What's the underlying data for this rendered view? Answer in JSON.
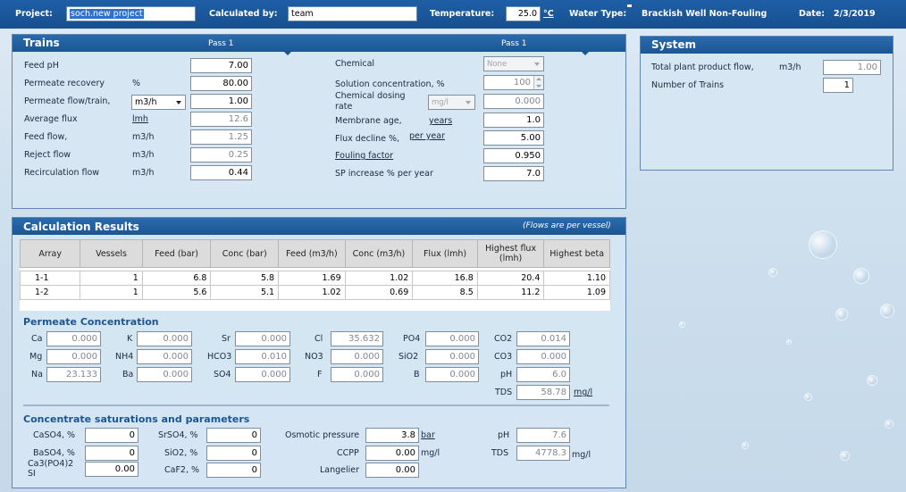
{
  "topbar": {
    "project_label": "Project:",
    "project_value": "soch.new project",
    "calculated_by_label": "Calculated by:",
    "calculated_by_value": "team",
    "temperature_label": "Temperature:",
    "temperature_value": "25.0",
    "temperature_unit": "°C",
    "water_type_label": "Water Type:",
    "water_type_value": "Brackish Well Non-Fouling",
    "date_label": "Date:",
    "date_value": "2/3/2019"
  },
  "trains": {
    "title": "Trains",
    "pass1_label_left": "Pass 1",
    "pass1_label_right": "Pass 1",
    "rows": [
      {
        "label": "Feed pH",
        "unit": "",
        "value": "7.00",
        "gray": false
      },
      {
        "label": "Permeate recovery",
        "unit": "%",
        "value": "80.00",
        "gray": false
      },
      {
        "label": "Permeate flow/train,",
        "unit": "m3/h",
        "value": "1.00",
        "gray": false
      },
      {
        "label": "Average flux",
        "unit": "lmh",
        "value": "12.6",
        "gray": true
      },
      {
        "label": "Feed flow,",
        "unit": "m3/h",
        "value": "1.25",
        "gray": true
      },
      {
        "label": "Reject flow",
        "unit": "m3/h",
        "value": "0.25",
        "gray": true
      },
      {
        "label": "Recirculation flow",
        "unit": "m3/h",
        "value": "0.44",
        "gray": false
      }
    ],
    "chemical_label": "Chemical",
    "chemical_value": "None",
    "solution_conc_label": "Solution concentration, %",
    "solution_conc_value": "100",
    "dosing_label_line1": "Chemical dosing",
    "dosing_label_line2": "rate",
    "dosing_unit": "mg/l",
    "dosing_value": "0.000",
    "membrane_age_label": "Membrane age,",
    "membrane_age_unit": "years",
    "membrane_age_value": "1.0",
    "flux_decline_label": "Flux decline %,",
    "flux_decline_unit": "per year",
    "flux_decline_value": "5.00",
    "fouling_label": "Fouling factor",
    "fouling_value": "0.950",
    "sp_increase_label": "SP increase % per year",
    "sp_increase_value": "7.0"
  },
  "system": {
    "title": "System",
    "product_flow_label": "Total plant product flow,",
    "product_flow_unit": "m3/h",
    "product_flow_value": "1.00",
    "num_trains_label": "Number of Trains",
    "num_trains_value": "1"
  },
  "results": {
    "title": "Calculation Results",
    "note": "(Flows are per vessel)",
    "headers": [
      "Array",
      "Vessels",
      "Feed (bar)",
      "Conc (bar)",
      "Feed (m3/h)",
      "Conc (m3/h)",
      "Flux (lmh)",
      "Highest flux (lmh)",
      "Highest beta"
    ],
    "rows": [
      [
        "1-1",
        "1",
        "6.8",
        "5.8",
        "1.69",
        "1.02",
        "16.8",
        "20.4",
        "1.10"
      ],
      [
        "1-2",
        "1",
        "5.6",
        "5.1",
        "1.02",
        "0.69",
        "8.5",
        "11.2",
        "1.09"
      ]
    ]
  },
  "permeate": {
    "title": "Permeate Concentration",
    "cols": [
      [
        {
          "label": "Ca",
          "value": "0.000"
        },
        {
          "label": "Mg",
          "value": "0.000"
        },
        {
          "label": "Na",
          "value": "23.133"
        }
      ],
      [
        {
          "label": "K",
          "value": "0.000"
        },
        {
          "label": "NH4",
          "value": "0.000"
        },
        {
          "label": "Ba",
          "value": "0.000"
        }
      ],
      [
        {
          "label": "Sr",
          "value": "0.000"
        },
        {
          "label": "HCO3",
          "value": "0.010"
        },
        {
          "label": "SO4",
          "value": "0.000"
        }
      ],
      [
        {
          "label": "Cl",
          "value": "35.632"
        },
        {
          "label": "NO3",
          "value": "0.000"
        },
        {
          "label": "F",
          "value": "0.000"
        }
      ],
      [
        {
          "label": "PO4",
          "value": "0.000"
        },
        {
          "label": "SiO2",
          "value": "0.000"
        },
        {
          "label": "B",
          "value": "0.000"
        }
      ],
      [
        {
          "label": "CO2",
          "value": "0.014"
        },
        {
          "label": "CO3",
          "value": "0.000"
        },
        {
          "label": "pH",
          "value": "6.0"
        }
      ]
    ],
    "tds_label": "TDS",
    "tds_value": "58.78",
    "tds_unit": "mg/l"
  },
  "concentrate": {
    "title": "Concentrate saturations and parameters",
    "caso4_label": "CaSO4, %",
    "caso4_value": "0",
    "baso4_label": "BaSO4, %",
    "baso4_value": "0",
    "capo4_label_line1": "Ca3(PO4)2",
    "capo4_label_line2": "SI",
    "capo4_value": "0.00",
    "srso4_label": "SrSO4, %",
    "srso4_value": "0",
    "sio2_label": "SiO2, %",
    "sio2_value": "0",
    "caf2_label": "CaF2, %",
    "caf2_value": "0",
    "osmotic_label": "Osmotic pressure",
    "osmotic_value": "3.8",
    "osmotic_unit": "bar",
    "ccpp_label": "CCPP",
    "ccpp_value": "0.00",
    "ccpp_unit": "mg/l",
    "langelier_label": "Langelier",
    "langelier_value": "0.00",
    "ph_label": "pH",
    "ph_value": "7.6",
    "tds_label": "TDS",
    "tds_value": "4778.3",
    "tds_unit": "mg/l"
  }
}
